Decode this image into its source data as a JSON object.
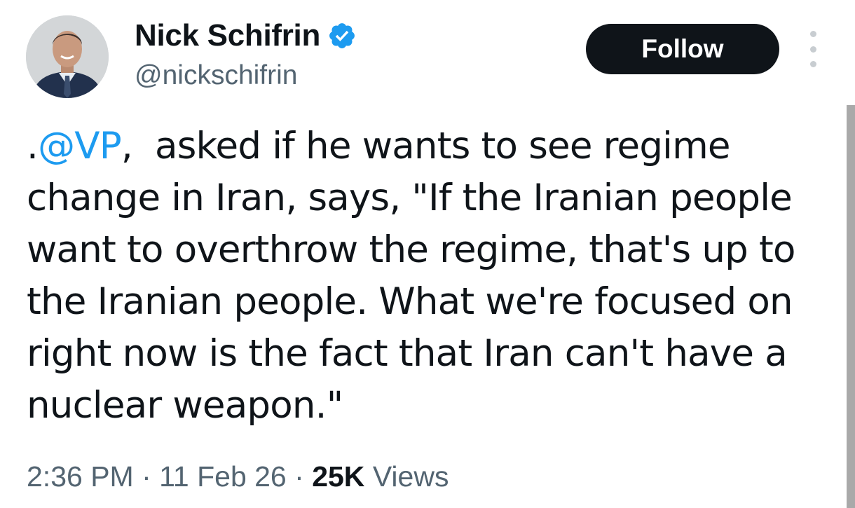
{
  "author": {
    "display_name": "Nick Schifrin",
    "handle": "@nickschifrin",
    "verified_icon": "verified-badge-icon",
    "verified_color": "#1d9bf0"
  },
  "actions": {
    "follow_label": "Follow",
    "more_icon": "more-vertical-icon"
  },
  "tweet": {
    "text_prefix": ".",
    "mention": "@VP",
    "text_body": ",  asked if he wants to see regime change in Iran, says, \"If the Iranian people want to overthrow the regime, that's up to the Iranian people. What we're focused on right now is the fact that Iran can't have a nuclear weapon.\"",
    "time": "2:36 PM",
    "separator": " · ",
    "date": "11 Feb 26",
    "views_count": "25K",
    "views_label": "Views"
  },
  "colors": {
    "accent": "#1d9bf0",
    "text": "#0f1419",
    "secondary_text": "#536471",
    "button_bg": "#0f1419"
  }
}
